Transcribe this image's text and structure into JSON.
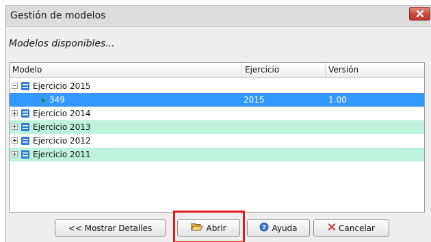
{
  "window": {
    "title": "Gestión de modelos",
    "subtitle": "Modelos disponibles..."
  },
  "grid": {
    "columns": [
      "Modelo",
      "Ejercicio",
      "Versión"
    ],
    "rows": [
      {
        "label": "Ejercicio 2015",
        "ejercicio": "",
        "version": "",
        "expanded": true,
        "style": "normal"
      },
      {
        "label": "349",
        "ejercicio": "2015",
        "version": "1.00",
        "child": true,
        "style": "selected"
      },
      {
        "label": "Ejercicio 2014",
        "ejercicio": "",
        "version": "",
        "expanded": false,
        "style": "normal"
      },
      {
        "label": "Ejercicio 2013",
        "ejercicio": "",
        "version": "",
        "expanded": false,
        "style": "alt"
      },
      {
        "label": "Ejercicio 2012",
        "ejercicio": "",
        "version": "",
        "expanded": false,
        "style": "normal"
      },
      {
        "label": "Ejercicio 2011",
        "ejercicio": "",
        "version": "",
        "expanded": false,
        "style": "alt"
      }
    ]
  },
  "buttons": {
    "details": "<< Mostrar Detalles",
    "open": "Abrir",
    "help": "Ayuda",
    "cancel": "Cancelar"
  },
  "colors": {
    "selected_row": "#3399ff",
    "alt_row": "#bdf3dc",
    "highlight": "#e01818",
    "close_button": "#c9493a"
  },
  "icons": {
    "close": "close-icon",
    "db": "database-icon",
    "child": "triangle-right-icon",
    "open": "folder-open-icon",
    "help": "help-icon",
    "cancel": "cancel-x-icon"
  }
}
